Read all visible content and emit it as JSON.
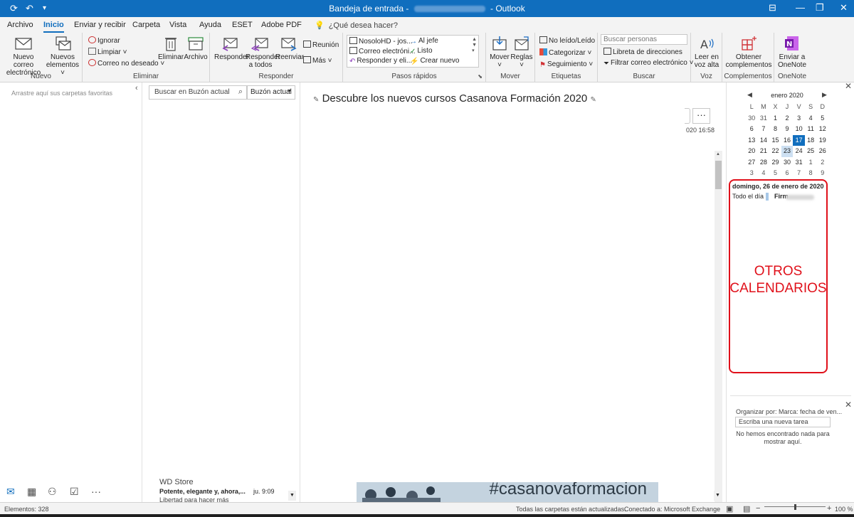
{
  "window": {
    "title_prefix": "Bandeja de entrada - ",
    "title_suffix": " - Outlook"
  },
  "tabs": [
    "Archivo",
    "Inicio",
    "Enviar y recibir",
    "Carpeta",
    "Vista",
    "Ayuda",
    "ESET",
    "Adobe PDF"
  ],
  "active_tab": "Inicio",
  "tell_me": "¿Qué desea hacer?",
  "ribbon": {
    "nuevo": {
      "label": "Nuevo",
      "new_mail_1": "Nuevo correo",
      "new_mail_2": "electrónico",
      "new_items_1": "Nuevos",
      "new_items_2": "elementos ˅"
    },
    "eliminar": {
      "label": "Eliminar",
      "ignore": "Ignorar",
      "clean": "Limpiar ˅",
      "junk": "Correo no deseado ˅",
      "delete": "Eliminar",
      "archive": "Archivo"
    },
    "responder": {
      "label": "Responder",
      "reply": "Responder",
      "reply_all_1": "Responder",
      "reply_all_2": "a todos",
      "forward": "Reenviar",
      "meeting": "Reunión",
      "more": "Más ˅"
    },
    "pasos": {
      "label": "Pasos rápidos",
      "items": [
        "NosoloHD - jos...",
        "Correo electróni...",
        "Responder y eli...",
        "Al jefe",
        "Listo",
        "Crear nuevo"
      ]
    },
    "mover": {
      "label": "Mover",
      "move": "Mover",
      "rules": "Reglas",
      "caret": "˅"
    },
    "etiquetas": {
      "label": "Etiquetas",
      "unread": "No leído/Leído",
      "categorize": "Categorizar ˅",
      "follow": "Seguimiento ˅"
    },
    "buscar": {
      "label": "Buscar",
      "people_placeholder": "Buscar personas",
      "address_book": "Libreta de direcciones",
      "filter": "Filtrar correo electrónico ˅"
    },
    "voz": {
      "label": "Voz",
      "read_1": "Leer en",
      "read_2": "voz alta"
    },
    "complementos": {
      "label": "Complementos",
      "get_1": "Obtener",
      "get_2": "complementos"
    },
    "onenote": {
      "label": "OneNote",
      "send_1": "Enviar a",
      "send_2": "OneNote"
    }
  },
  "folders": {
    "favorites_hint": "Arrastre aquí sus carpetas favoritas"
  },
  "message_list": {
    "search_placeholder": "Buscar en Buzón actual",
    "scope": "Buzón actual",
    "items": [
      {
        "sender": "WD Store",
        "subject": "Potente, elegante y, ahora,...",
        "preview": "Libertad para hacer más",
        "date": "ju. 9:09"
      }
    ]
  },
  "reading": {
    "subject": "Descubre los nuevos cursos Casanova Formación 2020",
    "date_fragment": "020 16:58",
    "more": "···",
    "banner_tag": "#casanovaformacion"
  },
  "calendar": {
    "month": "enero 2020",
    "weekdays": [
      "L",
      "M",
      "X",
      "J",
      "V",
      "S",
      "D"
    ],
    "weeks": [
      [
        "30",
        "31",
        "1",
        "2",
        "3",
        "4",
        "5"
      ],
      [
        "6",
        "7",
        "8",
        "9",
        "10",
        "11",
        "12"
      ],
      [
        "13",
        "14",
        "15",
        "16",
        "17",
        "18",
        "19"
      ],
      [
        "20",
        "21",
        "22",
        "23",
        "24",
        "25",
        "26"
      ],
      [
        "27",
        "28",
        "29",
        "30",
        "31",
        "1",
        "2"
      ],
      [
        "3",
        "4",
        "5",
        "6",
        "7",
        "8",
        "9"
      ]
    ],
    "today": "17",
    "selected": "23",
    "day_header": "domingo, 26 de enero de 2020",
    "all_day": "Todo el día",
    "event": "Firm",
    "annotation_1": "OTROS",
    "annotation_2": "CALENDARIOS"
  },
  "tasks": {
    "arrange": "Organizar por: Marca: fecha de ven...",
    "new_task_placeholder": "Escriba una nueva tarea",
    "empty_1": "No hemos encontrado nada para",
    "empty_2": "mostrar aquí."
  },
  "status": {
    "items": "Elementos: 328",
    "sync": "Todas las carpetas están actualizadas.",
    "connected": "Conectado a: Microsoft Exchange",
    "zoom": "100 %"
  },
  "colors": {
    "accent": "#106ebe",
    "annotation": "#e0101a"
  }
}
